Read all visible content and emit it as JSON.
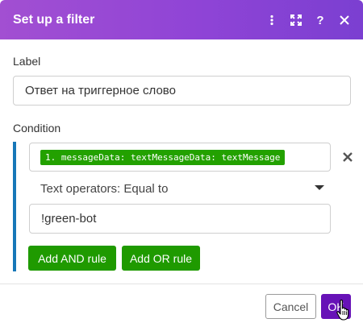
{
  "dialog": {
    "title": "Set up a filter",
    "header_icons": [
      "more-vertical-icon",
      "expand-icon",
      "help-icon",
      "close-icon"
    ],
    "header_colors": [
      "#a24fd2",
      "#7b3fd1"
    ]
  },
  "form": {
    "label_caption": "Label",
    "label_value": "Ответ на триггерное слово",
    "condition_caption": "Condition",
    "condition": {
      "field_pill": "1. messageData: textMessageData: textMessage",
      "operator": "Text operators: Equal to",
      "value": "!green-bot",
      "add_and_label": "Add AND rule",
      "add_or_label": "Add OR rule"
    }
  },
  "footer": {
    "cancel_label": "Cancel",
    "ok_label": "OK"
  },
  "colors": {
    "accent_green": "#1f9a00",
    "pill_green": "#23a100",
    "ok_purple": "#6712b7",
    "condition_bar": "#1677b8"
  }
}
